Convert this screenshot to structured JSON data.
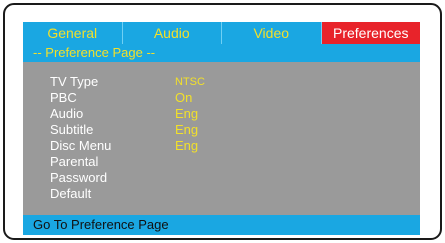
{
  "tabs": [
    {
      "label": "General",
      "active": false
    },
    {
      "label": "Audio",
      "active": false
    },
    {
      "label": "Video",
      "active": false
    },
    {
      "label": "Preferences",
      "active": true
    }
  ],
  "page_title": "-- Preference Page --",
  "settings": [
    {
      "label": "TV Type",
      "value": "NTSC"
    },
    {
      "label": "PBC",
      "value": "On"
    },
    {
      "label": "Audio",
      "value": "Eng"
    },
    {
      "label": "Subtitle",
      "value": "Eng"
    },
    {
      "label": "Disc Menu",
      "value": "Eng"
    },
    {
      "label": "Parental",
      "value": ""
    },
    {
      "label": "Password",
      "value": ""
    },
    {
      "label": "Default",
      "value": ""
    }
  ],
  "status_text": "Go To Preference Page",
  "colors": {
    "tab_bg": "#1aa7e2",
    "active_tab_bg": "#e8232a",
    "panel_bg": "#9a9a9a",
    "value_text": "#f2e02a"
  }
}
